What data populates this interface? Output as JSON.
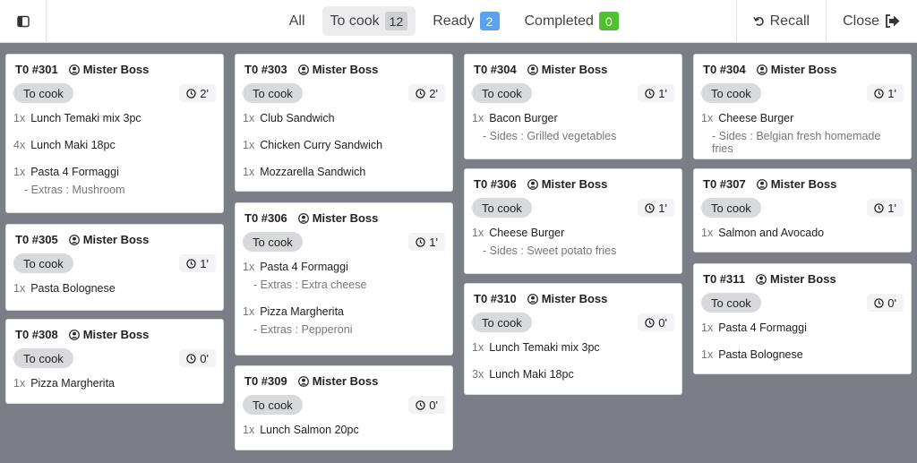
{
  "tabs": [
    {
      "label": "All",
      "count": null
    },
    {
      "label": "To cook",
      "count": "12"
    },
    {
      "label": "Ready",
      "count": "2"
    },
    {
      "label": "Completed",
      "count": "0"
    }
  ],
  "actions": {
    "recall": "Recall",
    "close": "Close"
  },
  "colors": {
    "background": "#7b7d87",
    "ready_badge": "#5aa2f0",
    "completed_badge": "#4fc02e"
  },
  "orders": [
    {
      "table": "T0 #301",
      "user": "Mister Boss",
      "status": "To cook",
      "timer": "2'",
      "items": [
        {
          "qty": "1x",
          "name": "Lunch Temaki mix 3pc"
        },
        {
          "qty": "4x",
          "name": "Lunch Maki 18pc"
        },
        {
          "qty": "1x",
          "name": "Pasta 4 Formaggi",
          "note": "- Extras : Mushroom"
        }
      ]
    },
    {
      "table": "T0 #305",
      "user": "Mister Boss",
      "status": "To cook",
      "timer": "1'",
      "items": [
        {
          "qty": "1x",
          "name": "Pasta Bolognese"
        }
      ]
    },
    {
      "table": "T0 #308",
      "user": "Mister Boss",
      "status": "To cook",
      "timer": "0'",
      "items": [
        {
          "qty": "1x",
          "name": "Pizza Margherita"
        }
      ]
    },
    {
      "table": "T0 #303",
      "user": "Mister Boss",
      "status": "To cook",
      "timer": "2'",
      "items": [
        {
          "qty": "1x",
          "name": "Club Sandwich"
        },
        {
          "qty": "1x",
          "name": "Chicken Curry Sandwich"
        },
        {
          "qty": "1x",
          "name": "Mozzarella Sandwich"
        }
      ]
    },
    {
      "table": "T0 #306",
      "user": "Mister Boss",
      "status": "To cook",
      "timer": "1'",
      "items": [
        {
          "qty": "1x",
          "name": "Pasta 4 Formaggi",
          "note": "- Extras : Extra cheese"
        },
        {
          "qty": "1x",
          "name": "Pizza Margherita",
          "note": "- Extras : Pepperoni"
        }
      ]
    },
    {
      "table": "T0 #309",
      "user": "Mister Boss",
      "status": "To cook",
      "timer": "0'",
      "items": [
        {
          "qty": "1x",
          "name": "Lunch Salmon 20pc"
        }
      ]
    },
    {
      "table": "T0 #304",
      "user": "Mister Boss",
      "status": "To cook",
      "timer": "1'",
      "items": [
        {
          "qty": "1x",
          "name": "Bacon Burger",
          "note": "- Sides : Grilled vegetables"
        }
      ]
    },
    {
      "table": "T0 #306",
      "user": "Mister Boss",
      "status": "To cook",
      "timer": "1'",
      "items": [
        {
          "qty": "1x",
          "name": "Cheese Burger",
          "note": "- Sides : Sweet potato fries"
        }
      ]
    },
    {
      "table": "T0 #310",
      "user": "Mister Boss",
      "status": "To cook",
      "timer": "0'",
      "items": [
        {
          "qty": "1x",
          "name": "Lunch Temaki mix 3pc"
        },
        {
          "qty": "3x",
          "name": "Lunch Maki 18pc"
        }
      ]
    },
    {
      "table": "T0 #304",
      "user": "Mister Boss",
      "status": "To cook",
      "timer": "1'",
      "items": [
        {
          "qty": "1x",
          "name": "Cheese Burger",
          "note": "- Sides : Belgian fresh homemade fries"
        }
      ]
    },
    {
      "table": "T0 #307",
      "user": "Mister Boss",
      "status": "To cook",
      "timer": "1'",
      "items": [
        {
          "qty": "1x",
          "name": "Salmon and Avocado"
        }
      ]
    },
    {
      "table": "T0 #311",
      "user": "Mister Boss",
      "status": "To cook",
      "timer": "0'",
      "items": [
        {
          "qty": "1x",
          "name": "Pasta 4 Formaggi"
        },
        {
          "qty": "1x",
          "name": "Pasta Bolognese"
        }
      ]
    }
  ]
}
